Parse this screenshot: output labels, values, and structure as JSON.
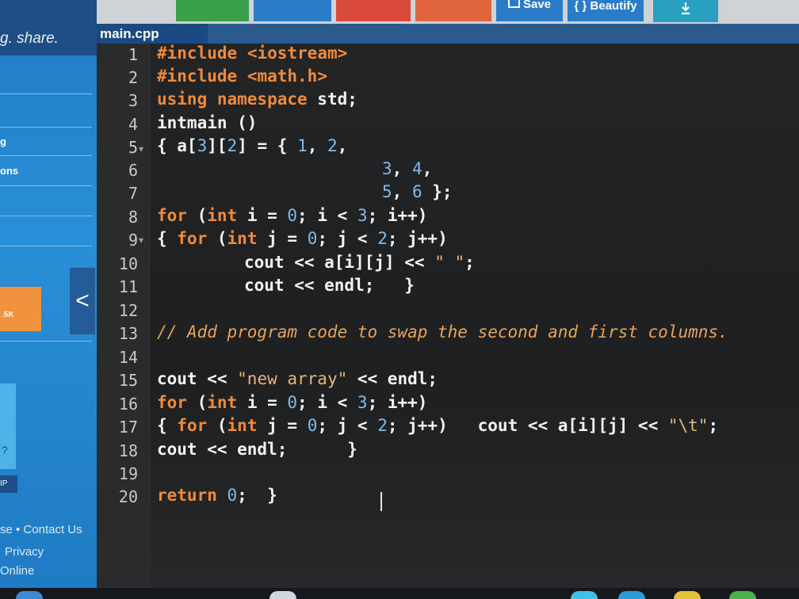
{
  "sidebar": {
    "tagline": "g. share.",
    "nav_fragment_1": "g",
    "nav_fragment_2": "ons",
    "badge": ".5K",
    "collapse_glyph": "<",
    "question_glyph": "?",
    "tag_fragment": "IP",
    "footer_contact": "se • Contact Us",
    "footer_privacy": "Privacy",
    "footer_online": "Online"
  },
  "toolbar": {
    "save_label": "Save",
    "beautify_label": "{ } Beautify",
    "colors": {
      "run": "#3aa14a",
      "debug": "#2a7cc8",
      "stop": "#d94a3c",
      "share": "#e0643c",
      "save": "#2a7cc8",
      "beautify": "#2a7cc8",
      "download": "#2aa0c0"
    },
    "download_icon": "download-icon"
  },
  "file_tab": {
    "name": "main.cpp"
  },
  "editor": {
    "lines": [
      {
        "n": "1",
        "code": "#include <iostream>"
      },
      {
        "n": "2",
        "code": "#include <math.h>"
      },
      {
        "n": "3",
        "code": "using namespace std;"
      },
      {
        "n": "4",
        "code": "intmain ()"
      },
      {
        "n": "5",
        "code": "{ a[3][2] = { 1, 2,"
      },
      {
        "n": "6",
        "code": "3, 4,"
      },
      {
        "n": "7",
        "code": "5, 6 };"
      },
      {
        "n": "8",
        "code": "for (int i = 0; i < 3; i++)"
      },
      {
        "n": "9",
        "code": "{ for (int j = 0; j < 2; j++)"
      },
      {
        "n": "10",
        "code": "cout << a[i][j] << \" \";"
      },
      {
        "n": "11",
        "code": "cout << endl;   }"
      },
      {
        "n": "12",
        "code": ""
      },
      {
        "n": "13",
        "code": "// Add program code to swap the second and first columns."
      },
      {
        "n": "14",
        "code": ""
      },
      {
        "n": "15",
        "code": "cout << \"new array\" << endl;"
      },
      {
        "n": "16",
        "code": "for (int i = 0; i < 3; i++)"
      },
      {
        "n": "17",
        "code": "{ for (int j = 0; j < 2; j++)   cout << a[i][j] << \"\\t\";"
      },
      {
        "n": "18",
        "code": "cout << endl;      }"
      },
      {
        "n": "19",
        "code": ""
      },
      {
        "n": "20",
        "code": "return 0;  }"
      }
    ]
  }
}
